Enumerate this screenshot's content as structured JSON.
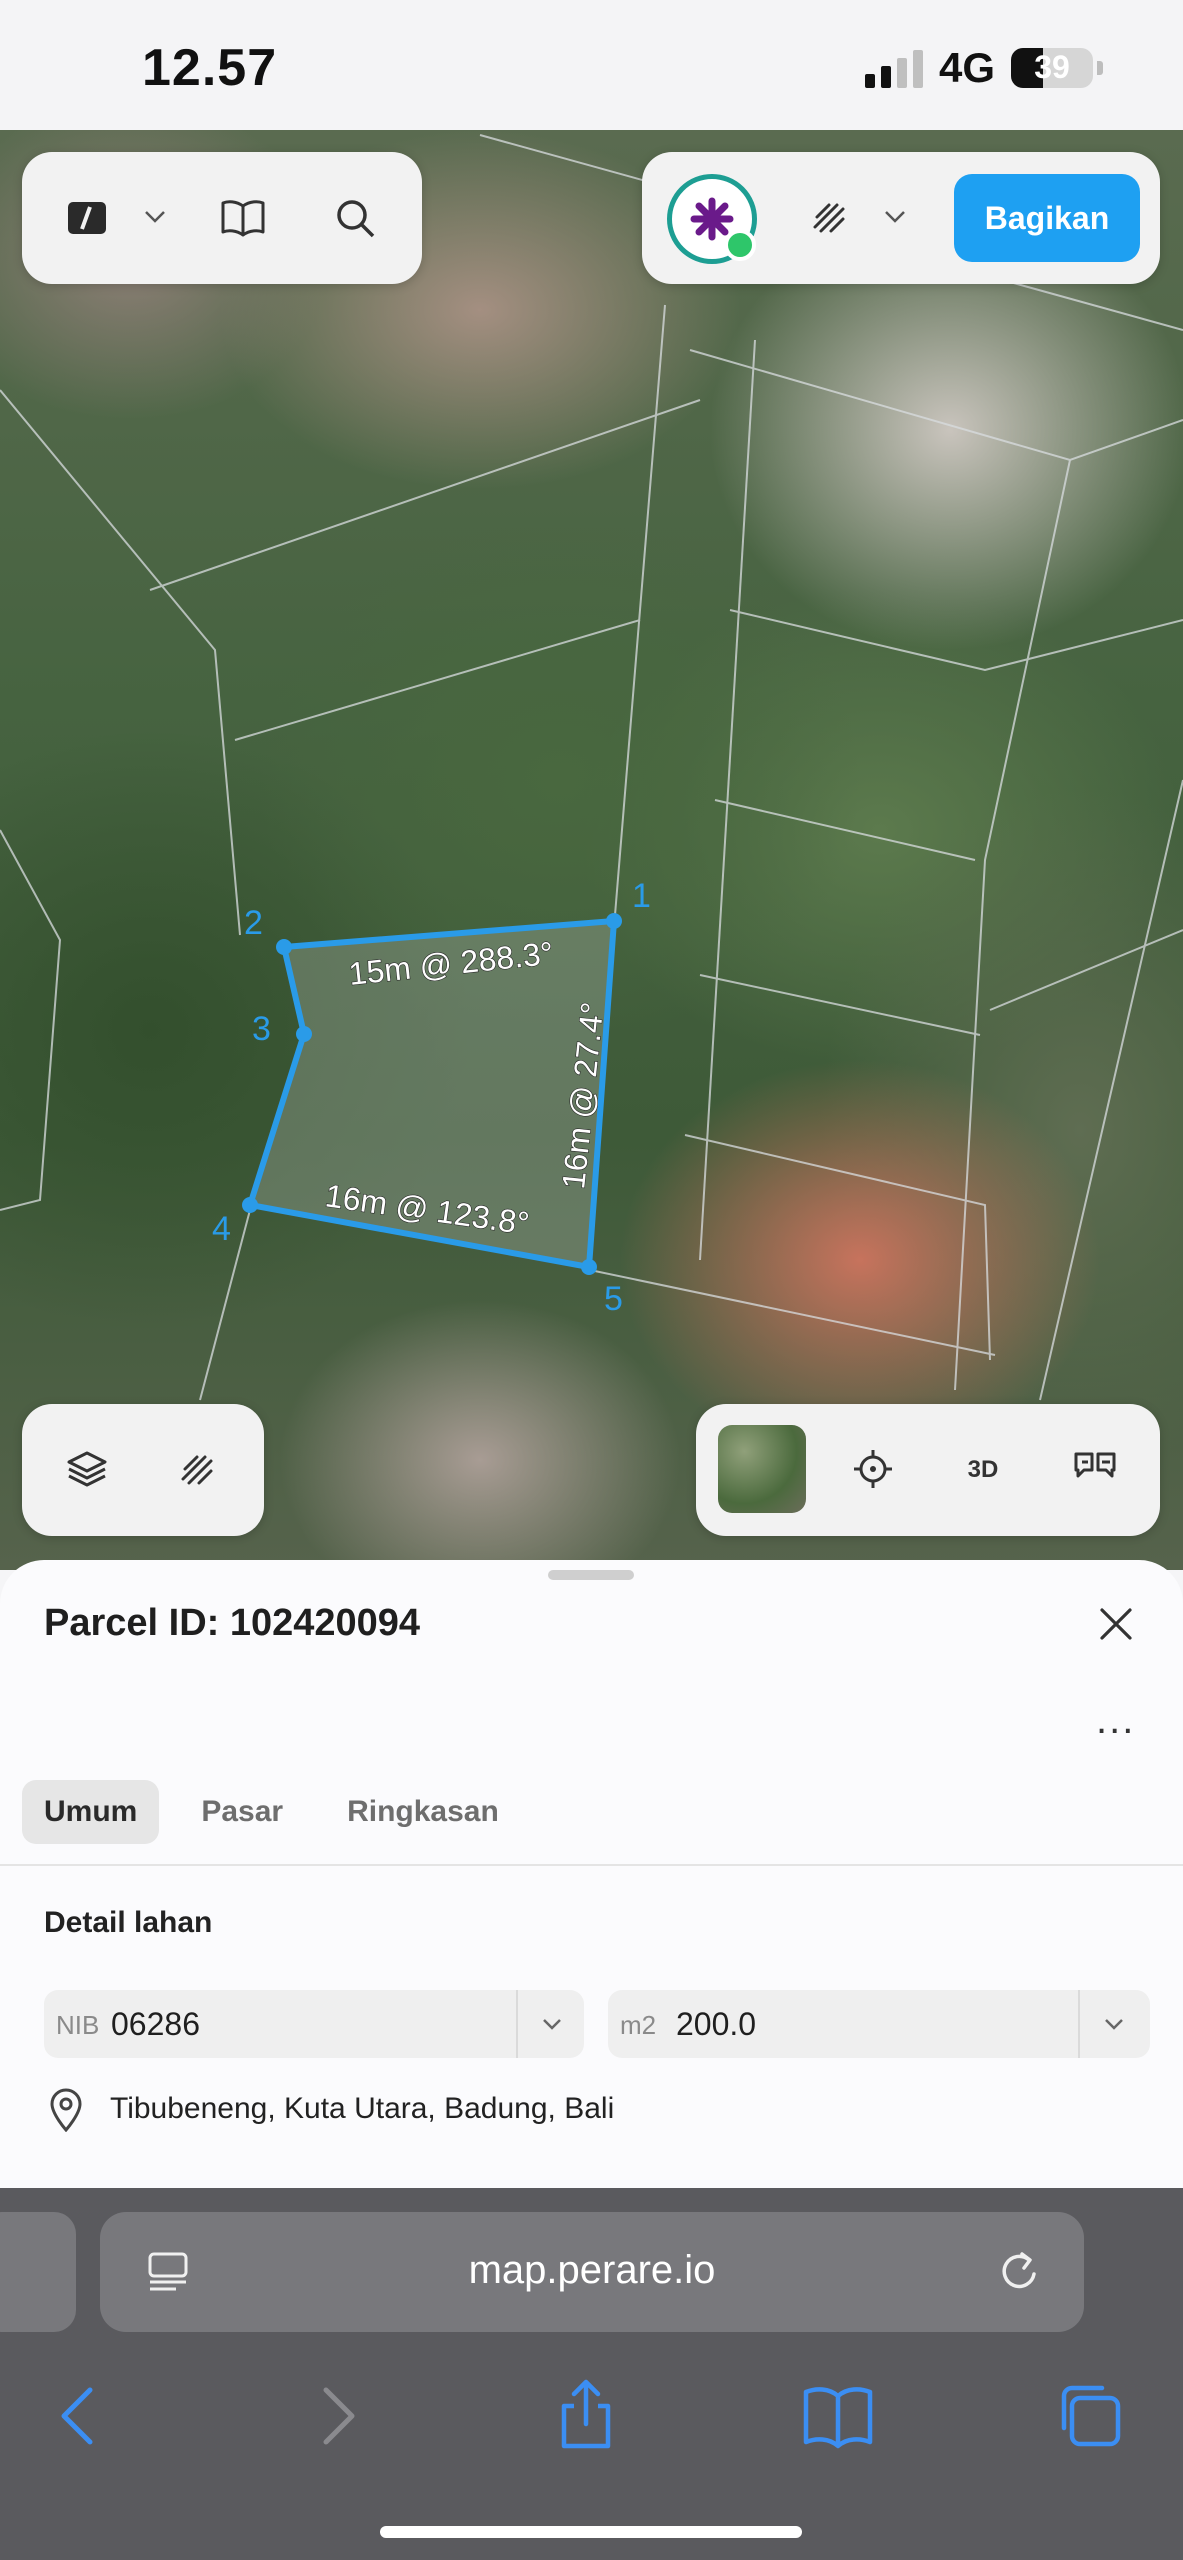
{
  "status_bar": {
    "time": "12.57",
    "network": "4G",
    "battery": "39",
    "battery_level": 0.39
  },
  "map": {
    "top_left_toolbar": {
      "icons": [
        "ruler-icon",
        "chevron-down-icon",
        "book-icon",
        "search-icon"
      ]
    },
    "top_right_toolbar": {
      "icons": [
        "avatar-icon",
        "draw-icon",
        "chevron-down-icon"
      ],
      "share_label": "Bagikan"
    },
    "parcel": {
      "vertex_labels": [
        "1",
        "2",
        "3",
        "4",
        "5"
      ],
      "edge_labels": [
        "15m @ 288.3°",
        "16m @ 27.4°",
        "16m @ 123.8°"
      ],
      "outline_color": "#2a9be8"
    },
    "bottom_left_toolbar": {
      "icons": [
        "layers-icon",
        "draw-icon"
      ]
    },
    "bottom_right_toolbar": {
      "icons": [
        "satellite-thumbnail",
        "locate-icon",
        "3d-icon",
        "feedback-icon"
      ],
      "three_d_label": "3D"
    }
  },
  "sheet": {
    "title": "Parcel ID: 102420094",
    "more_label": "...",
    "tabs": [
      {
        "label": "Umum",
        "active": true
      },
      {
        "label": "Pasar",
        "active": false
      },
      {
        "label": "Ringkasan",
        "active": false
      }
    ],
    "section_title": "Detail lahan",
    "nib": {
      "prefix": "NIB",
      "value": "06286"
    },
    "area": {
      "prefix": "m2",
      "value": "200.0"
    },
    "address": "Tibubeneng, Kuta Utara, Badung, Bali"
  },
  "browser": {
    "url": "map.perare.io",
    "nav_icons": [
      "back-icon",
      "forward-icon",
      "share-icon",
      "bookmarks-icon",
      "tabs-icon"
    ],
    "accent": "#3b8ef3"
  }
}
